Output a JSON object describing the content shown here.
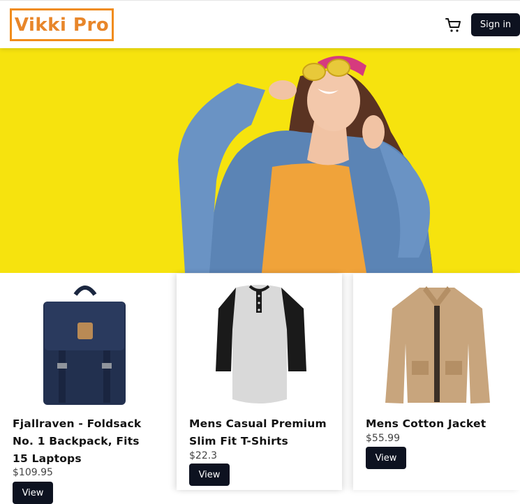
{
  "header": {
    "logo_text": "Vikki Pro",
    "signin_label": "Sign in",
    "cart_icon": "cart-icon"
  },
  "colors": {
    "brand": "#e8862a",
    "dark": "#0d1220",
    "hero_bg": "#f5e20c"
  },
  "products": [
    {
      "title": "Fjallraven - Foldsack No. 1 Backpack, Fits 15 Laptops",
      "price": "$109.95",
      "button": "View"
    },
    {
      "title": "Mens Casual Premium Slim Fit T-Shirts",
      "price": "$22.3",
      "button": "View"
    },
    {
      "title": "Mens Cotton Jacket",
      "price": "$55.99",
      "button": "View"
    }
  ]
}
